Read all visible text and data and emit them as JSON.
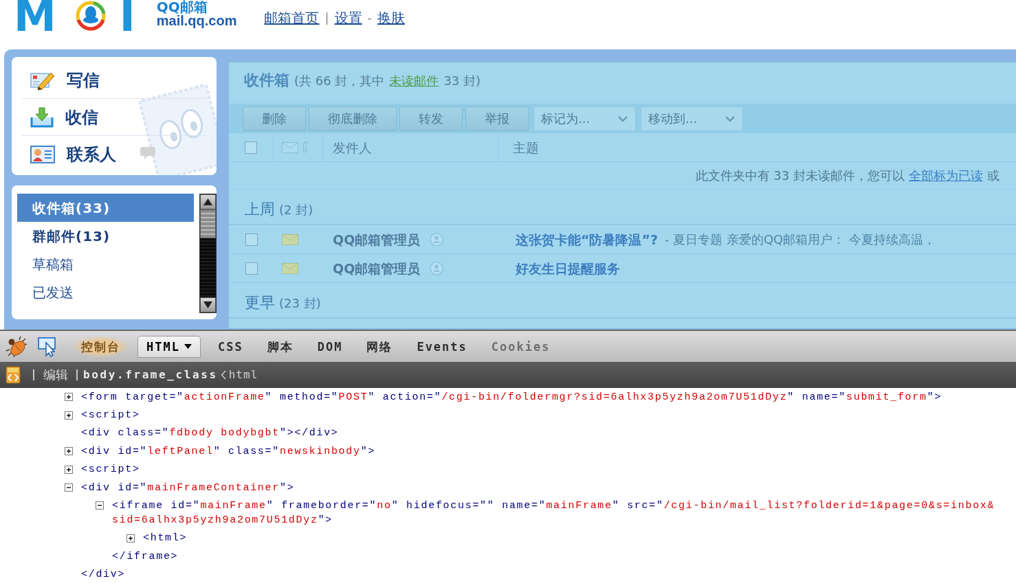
{
  "header": {
    "logo": {
      "left": "M",
      "right": "I",
      "name": "QQ邮箱",
      "domain": "mail.qq.com"
    },
    "nav": [
      {
        "kind": "link",
        "text": "邮箱首页"
      },
      {
        "kind": "separator",
        "text": "|"
      },
      {
        "kind": "link",
        "text": "设置"
      },
      {
        "kind": "separator",
        "text": "-"
      },
      {
        "kind": "link",
        "text": "换肤"
      }
    ]
  },
  "sidebar": {
    "actions": [
      {
        "kind": "compose",
        "label": "写信"
      },
      {
        "kind": "receive",
        "label": "收信"
      },
      {
        "kind": "contacts",
        "label": "联系人"
      }
    ],
    "folders": [
      {
        "label": "收件箱(33)",
        "selected": true,
        "unread": true
      },
      {
        "label": "群邮件(13)",
        "selected": false,
        "unread": true
      },
      {
        "label": "草稿箱",
        "selected": false,
        "unread": false
      },
      {
        "label": "已发送",
        "selected": false,
        "unread": false
      }
    ]
  },
  "mailbox": {
    "title": "收件箱",
    "summary_before": "(共 66 封，其中",
    "unread_link": "未读邮件",
    "summary_after": "33 封)",
    "toolbar": [
      {
        "kind": "button",
        "label": "删除"
      },
      {
        "kind": "button",
        "label": "彻底删除"
      },
      {
        "kind": "button",
        "label": "转发"
      },
      {
        "kind": "button",
        "label": "举报"
      },
      {
        "kind": "dropdown",
        "label": "标记为..."
      },
      {
        "kind": "dropdown",
        "label": "移动到..."
      }
    ],
    "list_header": {
      "checked": false,
      "sender": "发件人",
      "subject": "主题"
    },
    "notice": {
      "before": "此文件夹中有 33 封未读邮件，您可以",
      "link": "全部标为已读",
      "after": "或"
    },
    "groups": [
      {
        "label": "上周",
        "count": "(2 封)",
        "rows": [
          {
            "checked": false,
            "unread": true,
            "sender": "QQ邮箱管理员",
            "subject": "这张贺卡能“防暑降温”?",
            "preview": "- 夏日专题 亲爱的QQ邮箱用户： 今夏持续高温，"
          },
          {
            "checked": false,
            "unread": true,
            "sender": "QQ邮箱管理员",
            "subject": "好友生日提醒服务"
          }
        ]
      },
      {
        "label": "更早",
        "count": "(23 封)"
      }
    ]
  },
  "devtools": {
    "tabs": [
      {
        "label": "控制台",
        "selected": false,
        "highlighted": true,
        "disabled": false,
        "menu": false
      },
      {
        "label": "HTML",
        "selected": true,
        "highlighted": false,
        "disabled": false,
        "menu": true
      },
      {
        "label": "CSS",
        "selected": false,
        "highlighted": false,
        "disabled": false,
        "menu": false
      },
      {
        "label": "脚本",
        "selected": false,
        "highlighted": false,
        "disabled": false,
        "menu": false
      },
      {
        "label": "DOM",
        "selected": false,
        "highlighted": false,
        "disabled": false,
        "menu": false
      },
      {
        "label": "网络",
        "selected": false,
        "highlighted": false,
        "disabled": false,
        "menu": false
      },
      {
        "label": "Events",
        "selected": false,
        "highlighted": false,
        "disabled": false,
        "menu": false
      },
      {
        "label": "Cookies",
        "selected": false,
        "highlighted": false,
        "disabled": true,
        "menu": false
      }
    ],
    "edit_button": "编辑",
    "breadcrumbs": [
      {
        "label": "body.frame_class",
        "selected": true
      },
      {
        "label": "html",
        "selected": false
      }
    ],
    "html_tree": [
      {
        "kind": "branch",
        "expanded": false,
        "tokens": [
          {
            "kind": "markup",
            "text": "<form target=\""
          },
          {
            "kind": "value",
            "text": "actionFrame"
          },
          {
            "kind": "markup",
            "text": "\" method=\""
          },
          {
            "kind": "value",
            "text": "POST"
          },
          {
            "kind": "markup",
            "text": "\" action=\""
          },
          {
            "kind": "value",
            "text": "/cgi-bin/foldermgr?sid=6alhx3p5yzh9a2om7U51dDyz"
          },
          {
            "kind": "markup",
            "text": "\" name=\""
          },
          {
            "kind": "value",
            "text": "submit_form"
          },
          {
            "kind": "markup",
            "text": "\">"
          }
        ]
      },
      {
        "kind": "branch",
        "expanded": false,
        "tokens": [
          {
            "kind": "markup",
            "text": "<script>"
          }
        ]
      },
      {
        "kind": "leaf",
        "tokens": [
          {
            "kind": "markup",
            "text": "<div class=\""
          },
          {
            "kind": "value",
            "text": "fdbody bodybgbt"
          },
          {
            "kind": "markup",
            "text": "\"></div>"
          }
        ]
      },
      {
        "kind": "branch",
        "expanded": false,
        "tokens": [
          {
            "kind": "markup",
            "text": "<div id=\""
          },
          {
            "kind": "value",
            "text": "leftPanel"
          },
          {
            "kind": "markup",
            "text": "\" class=\""
          },
          {
            "kind": "value",
            "text": "newskinbody"
          },
          {
            "kind": "markup",
            "text": "\">"
          }
        ]
      },
      {
        "kind": "branch",
        "expanded": false,
        "tokens": [
          {
            "kind": "markup",
            "text": "<script>"
          }
        ]
      },
      {
        "kind": "branch",
        "expanded": true,
        "tokens": [
          {
            "kind": "markup",
            "text": "<div id=\""
          },
          {
            "kind": "value",
            "text": "mainFrameContainer"
          },
          {
            "kind": "markup",
            "text": "\">"
          }
        ],
        "children": [
          {
            "kind": "branch",
            "expanded": true,
            "tokens": [
              {
                "kind": "markup",
                "text": "<iframe id=\""
              },
              {
                "kind": "value",
                "text": "mainFrame"
              },
              {
                "kind": "markup",
                "text": "\" frameborder=\""
              },
              {
                "kind": "value",
                "text": "no"
              },
              {
                "kind": "markup",
                "text": "\" hidefocus=\"\" name=\""
              },
              {
                "kind": "value",
                "text": "mainFrame"
              },
              {
                "kind": "markup",
                "text": "\" src=\""
              },
              {
                "kind": "value",
                "text": "/cgi-bin/mail_list?folderid=1&page=0&s=inbox&sid=6alhx3p5yzh9a2om7U51dDyz"
              },
              {
                "kind": "markup",
                "text": "\">"
              }
            ],
            "children": [
              {
                "kind": "branch",
                "expanded": false,
                "tokens": [
                  {
                    "kind": "markup",
                    "text": "<html>"
                  }
                ]
              }
            ],
            "closing": [
              {
                "kind": "markup",
                "text": "</iframe>"
              }
            ]
          }
        ],
        "closing": [
          {
            "kind": "markup",
            "text": "</div>"
          }
        ]
      }
    ]
  }
}
